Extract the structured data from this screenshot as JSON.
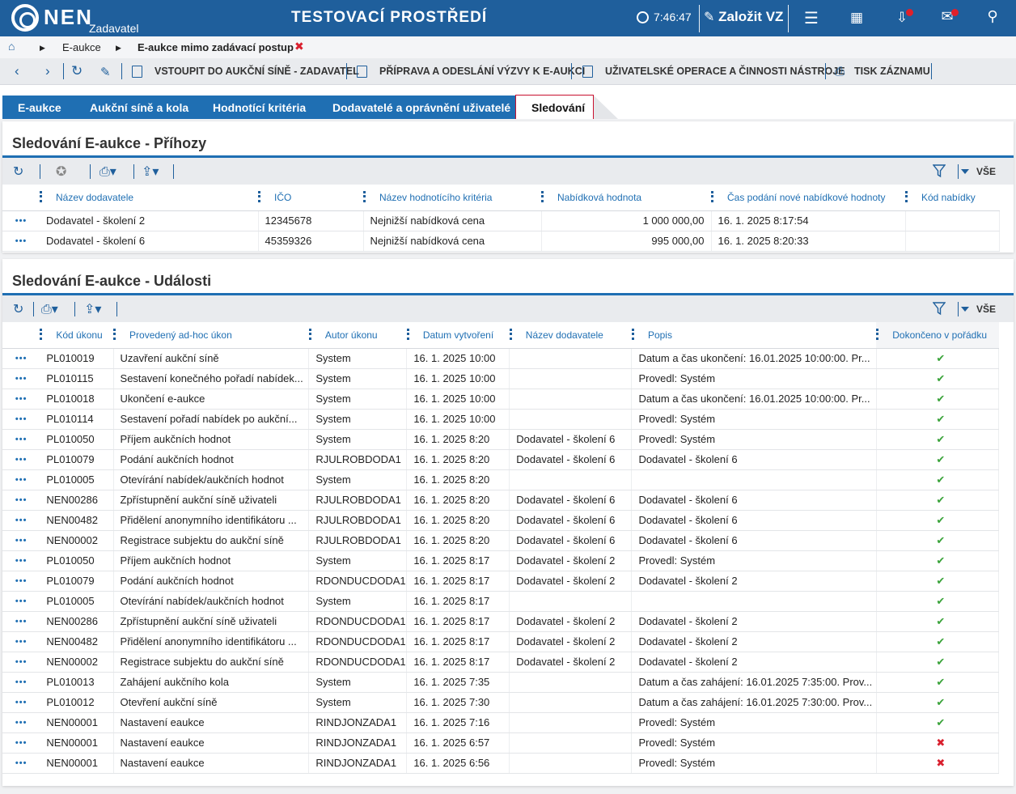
{
  "header": {
    "brand": "NEN",
    "brand_sub": "Zadavatel",
    "env_title": "TESTOVACÍ PROSTŘEDÍ",
    "clock": "7:46:47",
    "create_label": "Založit VZ"
  },
  "breadcrumb": {
    "item1": "E-aukce",
    "item2": "E-aukce mimo zadávací postup"
  },
  "toolbar": {
    "enter_room": "VSTOUPIT DO AUKČNÍ SÍNĚ - ZADAVATEL",
    "prepare": "PŘÍPRAVA A ODESLÁNÍ VÝZVY K E-AUKCI",
    "user_ops": "UŽIVATELSKÉ OPERACE A ČINNOSTI NÁSTROJE",
    "print": "TISK ZÁZNAMU"
  },
  "tabs": [
    "E-aukce",
    "Aukční síně a kola",
    "Hodnotící kritéria",
    "Dodavatelé a oprávnění uživatelé",
    "Sledování"
  ],
  "bids": {
    "title": "Sledování E-aukce - Příhozy",
    "filter_label": "VŠE",
    "columns": [
      "Název dodavatele",
      "IČO",
      "Název hodnotícího kritéria",
      "Nabídková hodnota",
      "Čas podání nové nabídkové hodnoty",
      "Kód nabídky"
    ],
    "rows": [
      [
        "Dodavatel - školení 2",
        "12345678",
        "Nejnižší nabídková cena",
        "1 000 000,00",
        "16. 1. 2025 8:17:54",
        ""
      ],
      [
        "Dodavatel - školení 6",
        "45359326",
        "Nejnižší nabídková cena",
        "995 000,00",
        "16. 1. 2025 8:20:33",
        ""
      ]
    ]
  },
  "events": {
    "title": "Sledování E-aukce - Události",
    "filter_label": "VŠE",
    "columns": [
      "Kód úkonu",
      "Provedený ad-hoc úkon",
      "Autor úkonu",
      "Datum vytvoření",
      "Název dodavatele",
      "Popis",
      "Dokončeno v pořádku"
    ],
    "rows": [
      [
        "PL010019",
        "Uzavření aukční síně",
        "System",
        "16. 1. 2025 10:00",
        "",
        "Datum a čas ukončení: 16.01.2025 10:00:00. Pr...",
        "ok"
      ],
      [
        "PL010115",
        "Sestavení konečného pořadí nabídek...",
        "System",
        "16. 1. 2025 10:00",
        "",
        "Provedl: Systém",
        "ok"
      ],
      [
        "PL010018",
        "Ukončení e-aukce",
        "System",
        "16. 1. 2025 10:00",
        "",
        "Datum a čas ukončení: 16.01.2025 10:00:00. Pr...",
        "ok"
      ],
      [
        "PL010114",
        "Sestavení pořadí nabídek po aukční...",
        "System",
        "16. 1. 2025 10:00",
        "",
        "Provedl: Systém",
        "ok"
      ],
      [
        "PL010050",
        "Příjem aukčních hodnot",
        "System",
        "16. 1. 2025 8:20",
        "Dodavatel - školení 6",
        "Provedl: Systém",
        "ok"
      ],
      [
        "PL010079",
        "Podání aukčních hodnot",
        "RJULROBDODA1",
        "16. 1. 2025 8:20",
        "Dodavatel - školení 6",
        "Dodavatel - školení 6",
        "ok"
      ],
      [
        "PL010005",
        "Otevírání nabídek/aukčních hodnot",
        "System",
        "16. 1. 2025 8:20",
        "",
        "",
        "ok"
      ],
      [
        "NEN00286",
        "Zpřístupnění aukční síně uživateli",
        "RJULROBDODA1",
        "16. 1. 2025 8:20",
        "Dodavatel - školení 6",
        "Dodavatel - školení 6",
        "ok"
      ],
      [
        "NEN00482",
        "Přidělení anonymního identifikátoru ...",
        "RJULROBDODA1",
        "16. 1. 2025 8:20",
        "Dodavatel - školení 6",
        "Dodavatel - školení 6",
        "ok"
      ],
      [
        "NEN00002",
        "Registrace subjektu do aukční síně",
        "RJULROBDODA1",
        "16. 1. 2025 8:20",
        "Dodavatel - školení 6",
        "Dodavatel - školení 6",
        "ok"
      ],
      [
        "PL010050",
        "Příjem aukčních hodnot",
        "System",
        "16. 1. 2025 8:17",
        "Dodavatel - školení 2",
        "Provedl: Systém",
        "ok"
      ],
      [
        "PL010079",
        "Podání aukčních hodnot",
        "RDONDUCDODA1",
        "16. 1. 2025 8:17",
        "Dodavatel - školení 2",
        "Dodavatel - školení 2",
        "ok"
      ],
      [
        "PL010005",
        "Otevírání nabídek/aukčních hodnot",
        "System",
        "16. 1. 2025 8:17",
        "",
        "",
        "ok"
      ],
      [
        "NEN00286",
        "Zpřístupnění aukční síně uživateli",
        "RDONDUCDODA1",
        "16. 1. 2025 8:17",
        "Dodavatel - školení 2",
        "Dodavatel - školení 2",
        "ok"
      ],
      [
        "NEN00482",
        "Přidělení anonymního identifikátoru ...",
        "RDONDUCDODA1",
        "16. 1. 2025 8:17",
        "Dodavatel - školení 2",
        "Dodavatel - školení 2",
        "ok"
      ],
      [
        "NEN00002",
        "Registrace subjektu do aukční síně",
        "RDONDUCDODA1",
        "16. 1. 2025 8:17",
        "Dodavatel - školení 2",
        "Dodavatel - školení 2",
        "ok"
      ],
      [
        "PL010013",
        "Zahájení aukčního kola",
        "System",
        "16. 1. 2025 7:35",
        "",
        "Datum a čas zahájení: 16.01.2025 7:35:00. Prov...",
        "ok"
      ],
      [
        "PL010012",
        "Otevření aukční síně",
        "System",
        "16. 1. 2025 7:30",
        "",
        "Datum a čas zahájení: 16.01.2025 7:30:00. Prov...",
        "ok"
      ],
      [
        "NEN00001",
        "Nastavení eaukce",
        "RINDJONZADA1",
        "16. 1. 2025 7:16",
        "",
        "Provedl: Systém",
        "ok"
      ],
      [
        "NEN00001",
        "Nastavení eaukce",
        "RINDJONZADA1",
        "16. 1. 2025 6:57",
        "",
        "Provedl: Systém",
        "fail"
      ],
      [
        "NEN00001",
        "Nastavení eaukce",
        "RINDJONZADA1",
        "16. 1. 2025 6:56",
        "",
        "Provedl: Systém",
        "fail"
      ]
    ]
  },
  "colors": {
    "brand": "#1f5f9c",
    "tab": "#1f6fb3",
    "ok": "#3aa33a",
    "fail": "#d9202e"
  }
}
